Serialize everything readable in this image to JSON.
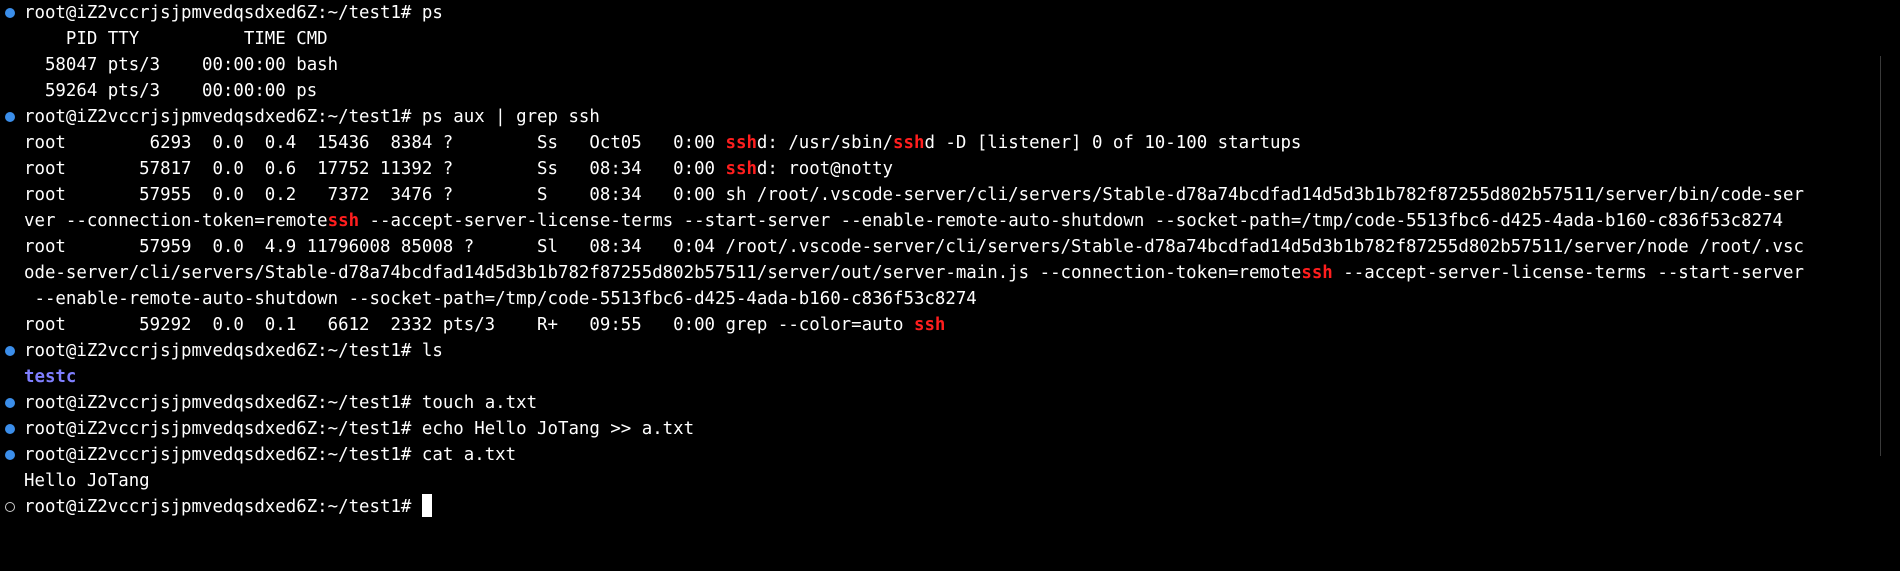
{
  "prompt": "root@iZ2vccrjsjpmvedqsdxed6Z:~/test1# ",
  "colors": {
    "background": "#000000",
    "foreground": "#ffffff",
    "grep_match": "#ff1e1e",
    "directory": "#7f7fff",
    "decoration_success": "#3b8eea",
    "decoration_pending": "#cccccc"
  },
  "lines": [
    {
      "kind": "command",
      "decoration": "success",
      "segments": [
        {
          "t": "root@iZ2vccrjsjpmvedqsdxed6Z:~/test1# "
        },
        {
          "t": "ps"
        }
      ]
    },
    {
      "kind": "output",
      "segments": [
        {
          "t": "    PID TTY          TIME CMD"
        }
      ]
    },
    {
      "kind": "output",
      "segments": [
        {
          "t": "  58047 pts/3    00:00:00 bash"
        }
      ]
    },
    {
      "kind": "output",
      "segments": [
        {
          "t": "  59264 pts/3    00:00:00 ps"
        }
      ]
    },
    {
      "kind": "command",
      "decoration": "success",
      "segments": [
        {
          "t": "root@iZ2vccrjsjpmvedqsdxed6Z:~/test1# "
        },
        {
          "t": "ps aux | grep ssh"
        }
      ]
    },
    {
      "kind": "output",
      "segments": [
        {
          "t": "root        6293  0.0  0.4  15436  8384 ?        Ss   Oct05   0:00 "
        },
        {
          "t": "ssh",
          "hl": true
        },
        {
          "t": "d: /usr/sbin/"
        },
        {
          "t": "ssh",
          "hl": true
        },
        {
          "t": "d -D [listener] 0 of 10-100 startups"
        }
      ]
    },
    {
      "kind": "output",
      "segments": [
        {
          "t": "root       57817  0.0  0.6  17752 11392 ?        Ss   08:34   0:00 "
        },
        {
          "t": "ssh",
          "hl": true
        },
        {
          "t": "d: root@notty"
        }
      ]
    },
    {
      "kind": "output",
      "segments": [
        {
          "t": "root       57955  0.0  0.2   7372  3476 ?        S    08:34   0:00 sh /root/.vscode-server/cli/servers/Stable-d78a74bcdfad14d5d3b1b782f87255d802b57511/server/bin/code-ser"
        }
      ]
    },
    {
      "kind": "output",
      "segments": [
        {
          "t": "ver --connection-token=remote"
        },
        {
          "t": "ssh",
          "hl": true
        },
        {
          "t": " --accept-server-license-terms --start-server --enable-remote-auto-shutdown --socket-path=/tmp/code-5513fbc6-d425-4ada-b160-c836f53c8274"
        }
      ]
    },
    {
      "kind": "output",
      "segments": [
        {
          "t": "root       57959  0.0  4.9 11796008 85008 ?      Sl   08:34   0:04 /root/.vscode-server/cli/servers/Stable-d78a74bcdfad14d5d3b1b782f87255d802b57511/server/node /root/.vsc"
        }
      ]
    },
    {
      "kind": "output",
      "segments": [
        {
          "t": "ode-server/cli/servers/Stable-d78a74bcdfad14d5d3b1b782f87255d802b57511/server/out/server-main.js --connection-token=remote"
        },
        {
          "t": "ssh",
          "hl": true
        },
        {
          "t": " --accept-server-license-terms --start-server"
        }
      ]
    },
    {
      "kind": "output",
      "segments": [
        {
          "t": " --enable-remote-auto-shutdown --socket-path=/tmp/code-5513fbc6-d425-4ada-b160-c836f53c8274"
        }
      ]
    },
    {
      "kind": "output",
      "segments": [
        {
          "t": "root       59292  0.0  0.1   6612  2332 pts/3    R+   09:55   0:00 grep --color=auto "
        },
        {
          "t": "ssh",
          "hl": true
        }
      ]
    },
    {
      "kind": "command",
      "decoration": "success",
      "segments": [
        {
          "t": "root@iZ2vccrjsjpmvedqsdxed6Z:~/test1# "
        },
        {
          "t": "ls"
        }
      ]
    },
    {
      "kind": "output",
      "segments": [
        {
          "t": "testc",
          "dir": true
        }
      ]
    },
    {
      "kind": "command",
      "decoration": "success",
      "segments": [
        {
          "t": "root@iZ2vccrjsjpmvedqsdxed6Z:~/test1# "
        },
        {
          "t": "touch a.txt"
        }
      ]
    },
    {
      "kind": "command",
      "decoration": "success",
      "segments": [
        {
          "t": "root@iZ2vccrjsjpmvedqsdxed6Z:~/test1# "
        },
        {
          "t": "echo Hello JoTang >> a.txt"
        }
      ]
    },
    {
      "kind": "command",
      "decoration": "success",
      "segments": [
        {
          "t": "root@iZ2vccrjsjpmvedqsdxed6Z:~/test1# "
        },
        {
          "t": "cat a.txt"
        }
      ]
    },
    {
      "kind": "output",
      "segments": [
        {
          "t": "Hello JoTang"
        }
      ]
    },
    {
      "kind": "input",
      "decoration": "pending",
      "segments": [
        {
          "t": "root@iZ2vccrjsjpmvedqsdxed6Z:~/test1# "
        }
      ],
      "cursor": true
    }
  ]
}
